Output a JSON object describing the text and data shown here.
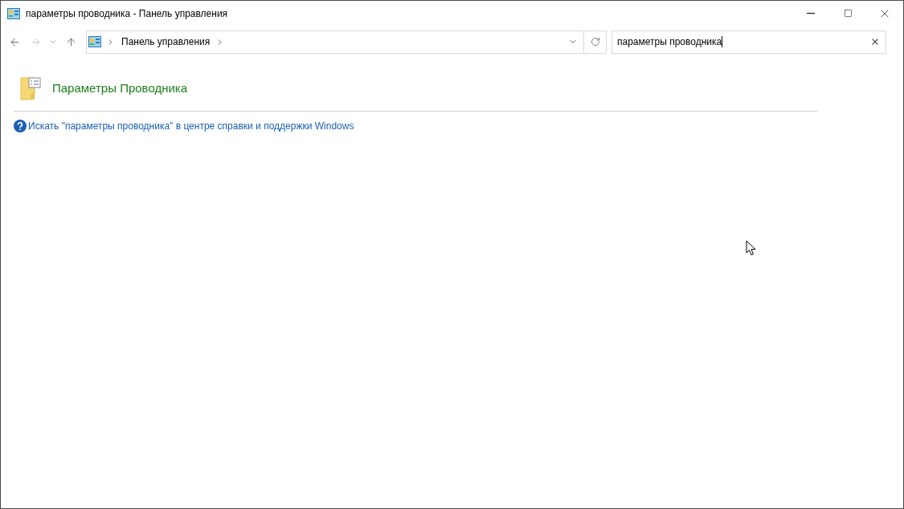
{
  "window": {
    "title": "параметры проводника - Панель управления"
  },
  "nav": [
    {
      "kind": "back",
      "disabled": false
    },
    {
      "kind": "forward",
      "disabled": true
    },
    {
      "kind": "recent",
      "disabled": false
    },
    {
      "kind": "up",
      "disabled": false
    }
  ],
  "address": {
    "crumbs": [
      "Панель управления"
    ]
  },
  "search": {
    "value": "параметры проводника"
  },
  "results": [
    {
      "title": "Параметры Проводника"
    }
  ],
  "help_link": "Искать \"параметры проводника\" в центре справки и поддержки Windows"
}
